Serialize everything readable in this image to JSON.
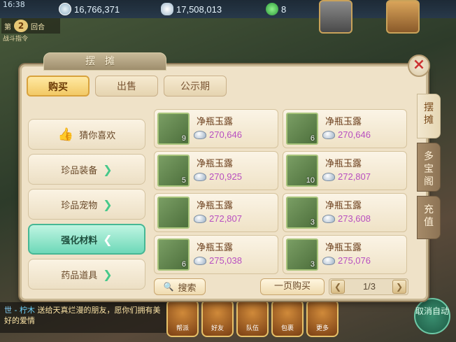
{
  "status": {
    "time": "16:38"
  },
  "resources": {
    "gold": "16,766,371",
    "silver": "17,508,013",
    "gems": "8"
  },
  "battle": {
    "round_prefix": "第",
    "round": "2",
    "round_suffix": "回合",
    "label": "战斗指令"
  },
  "panel": {
    "title": "摆摊",
    "tabs": [
      {
        "label": "购买",
        "active": true
      },
      {
        "label": "出售",
        "active": false
      },
      {
        "label": "公示期",
        "active": false
      }
    ],
    "categories": [
      {
        "label": "猜你喜欢",
        "icon": "thumbs-up-icon",
        "active": false
      },
      {
        "label": "珍品装备",
        "active": false
      },
      {
        "label": "珍品宠物",
        "active": false
      },
      {
        "label": "强化材料",
        "active": true
      },
      {
        "label": "药品道具",
        "active": false
      }
    ],
    "items": [
      {
        "name": "净瓶玉露",
        "qty": "9",
        "price": "270,646"
      },
      {
        "name": "净瓶玉露",
        "qty": "6",
        "price": "270,646"
      },
      {
        "name": "净瓶玉露",
        "qty": "5",
        "price": "270,925"
      },
      {
        "name": "净瓶玉露",
        "qty": "10",
        "price": "272,807"
      },
      {
        "name": "净瓶玉露",
        "qty": "",
        "price": "272,807"
      },
      {
        "name": "净瓶玉露",
        "qty": "3",
        "price": "273,608"
      },
      {
        "name": "净瓶玉露",
        "qty": "6",
        "price": "275,038"
      },
      {
        "name": "净瓶玉露",
        "qty": "3",
        "price": "275,076"
      }
    ],
    "search_label": "搜索",
    "buy_page_label": "一页购买",
    "page": "1/3",
    "side_tabs": [
      "摆摊",
      "多宝阁",
      "充值"
    ]
  },
  "chat": {
    "prefix": "世",
    "speaker": "- 柠木",
    "text": "送给天真烂漫的朋友，愿你们拥有美好的爱情"
  },
  "bottom_buttons": [
    "帮派",
    "好友",
    "队伍",
    "包裹",
    "更多"
  ],
  "auto_label": "取消自动"
}
